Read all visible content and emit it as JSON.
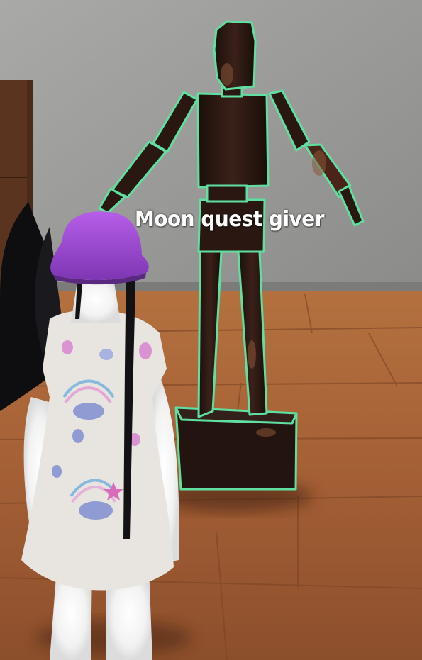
{
  "scene": {
    "description_kind": "third-person 3D game view",
    "npc": {
      "nameplate": "Moon quest giver",
      "outline_color": "#5fe0a0",
      "body_color": "#2a1712"
    },
    "player": {
      "hair_color": "#a24fd6",
      "wings_color": "#0d0d0f",
      "dress_color": "#e9e6e2"
    },
    "environment": {
      "wall_color": "#9c9c9c",
      "floor_color": "#a8683f"
    }
  }
}
